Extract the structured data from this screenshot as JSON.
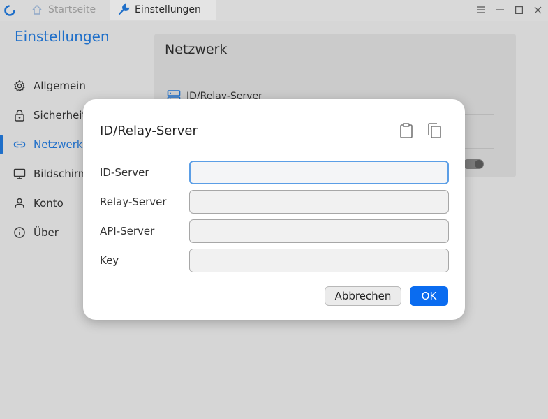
{
  "titlebar": {
    "tabs": [
      {
        "label": "Startseite",
        "icon": "home-icon"
      },
      {
        "label": "Einstellungen",
        "icon": "wrench-icon"
      }
    ],
    "controls": [
      "menu-icon",
      "minimize-icon",
      "maximize-icon",
      "close-icon"
    ]
  },
  "sidebar": {
    "title": "Einstellungen",
    "items": [
      {
        "label": "Allgemein",
        "icon": "gear-icon"
      },
      {
        "label": "Sicherheit",
        "icon": "lock-icon"
      },
      {
        "label": "Netzwerk",
        "icon": "link-icon",
        "active": true
      },
      {
        "label": "Bildschirm",
        "icon": "monitor-icon"
      },
      {
        "label": "Konto",
        "icon": "user-icon"
      },
      {
        "label": "Über",
        "icon": "info-icon"
      }
    ]
  },
  "main": {
    "card_title": "Netzwerk",
    "row_label": "ID/Relay-Server"
  },
  "dialog": {
    "title": "ID/Relay-Server",
    "fields": [
      {
        "label": "ID-Server",
        "value": ""
      },
      {
        "label": "Relay-Server",
        "value": ""
      },
      {
        "label": "API-Server",
        "value": ""
      },
      {
        "label": "Key",
        "value": ""
      }
    ],
    "cancel_label": "Abbrechen",
    "ok_label": "OK"
  },
  "colors": {
    "accent": "#1f6fc9",
    "ok_button": "#0a6cf0",
    "focus_border": "#5b9ee6"
  }
}
